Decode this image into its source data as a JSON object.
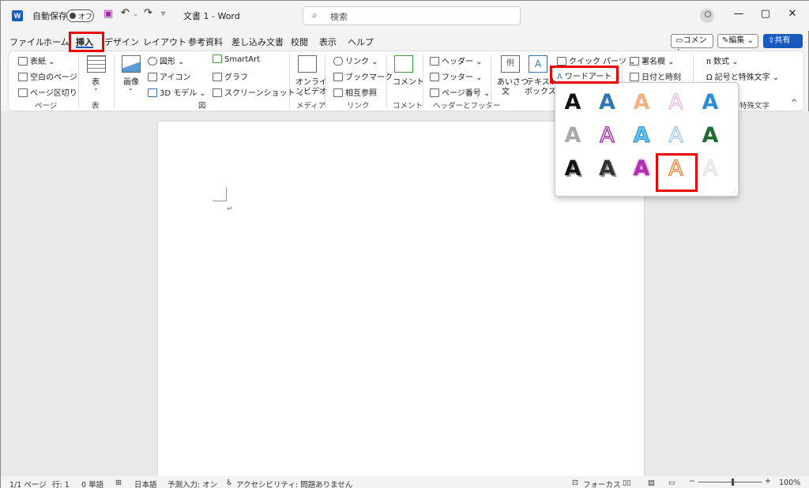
{
  "titlebar": {
    "autosave_label": "自動保存",
    "toggle_label": "オフ",
    "doc_title": "文書 1  -  Word",
    "search_placeholder": "検索"
  },
  "menu_tabs": [
    "ファイル",
    "ホーム",
    "挿入",
    "デザイン",
    "レイアウト",
    "参考資料",
    "差し込み文書",
    "校閲",
    "表示",
    "ヘルプ"
  ],
  "right_buttons": {
    "comment": "コメント",
    "edit": "編集",
    "share": "共有"
  },
  "ribbon": {
    "pages": {
      "cover": "表紙",
      "blank": "空白のページ",
      "break": "ページ区切り",
      "group": "ページ"
    },
    "table": {
      "label": "表",
      "group": "表"
    },
    "illustrations": {
      "image": "画像",
      "shapes": "図形",
      "icons": "アイコン",
      "model3d": "3D モデル",
      "smartart": "SmartArt",
      "chart": "グラフ",
      "screenshot": "スクリーンショット",
      "group": "図"
    },
    "media": {
      "video1": "オンライ",
      "video2": "ンビデオ",
      "group": "メディア"
    },
    "links": {
      "link": "リンク",
      "bookmark": "ブックマーク",
      "crossref": "相互参照",
      "group": "リンク"
    },
    "comments": {
      "comment": "コメント",
      "group": "コメント"
    },
    "headerfooter": {
      "header": "ヘッダー",
      "footer": "フッター",
      "pagenum": "ページ番号",
      "group": "ヘッダーとフッター"
    },
    "text": {
      "greeting1": "あいさつ",
      "greeting2": "文",
      "textbox1": "テキスト",
      "textbox2": "ボックス",
      "quickparts": "クイック パーツ",
      "wordart": "ワードアート",
      "sample_icon": "例"
    },
    "symbols": {
      "signature": "署名欄",
      "datetime": "日付と時刻",
      "equation": "数式",
      "symbol": "記号と特殊文字",
      "group": "特殊文字"
    }
  },
  "status": {
    "page": "1/1 ページ",
    "line": "行: 1",
    "words": "0 単語",
    "lang": "日本語",
    "predict": "予測入力: オン",
    "access": "アクセシビリティ: 問題ありません",
    "focus": "フォーカス",
    "zoom": "100%"
  },
  "wordart_gallery": {
    "glyph": "A",
    "styles": [
      {
        "color": "#111111",
        "style": "fill-black"
      },
      {
        "color": "#2e75b6",
        "style": "fill-blue"
      },
      {
        "color": "#f4b183",
        "style": "fill-orange-light"
      },
      {
        "color": "#e6b8e6",
        "style": "outline-pink"
      },
      {
        "color": "#2e8bd6",
        "style": "fill-blue-bright"
      },
      {
        "color": "#aaaaaa",
        "style": "fill-gray"
      },
      {
        "color": "#a020a0",
        "style": "outline-purple"
      },
      {
        "color": "#5bc0eb",
        "style": "fill-cyan"
      },
      {
        "color": "#9fc5e8",
        "style": "outline-blue"
      },
      {
        "color": "#1e6b2e",
        "style": "fill-green"
      },
      {
        "color": "#111111",
        "style": "shadow-black"
      },
      {
        "color": "#333333",
        "style": "shadow-gray"
      },
      {
        "color": "#b02fb0",
        "style": "fill-magenta"
      },
      {
        "color": "#ed7d31",
        "style": "outline-orange"
      },
      {
        "color": "#dddddd",
        "style": "outline-silver"
      }
    ]
  }
}
